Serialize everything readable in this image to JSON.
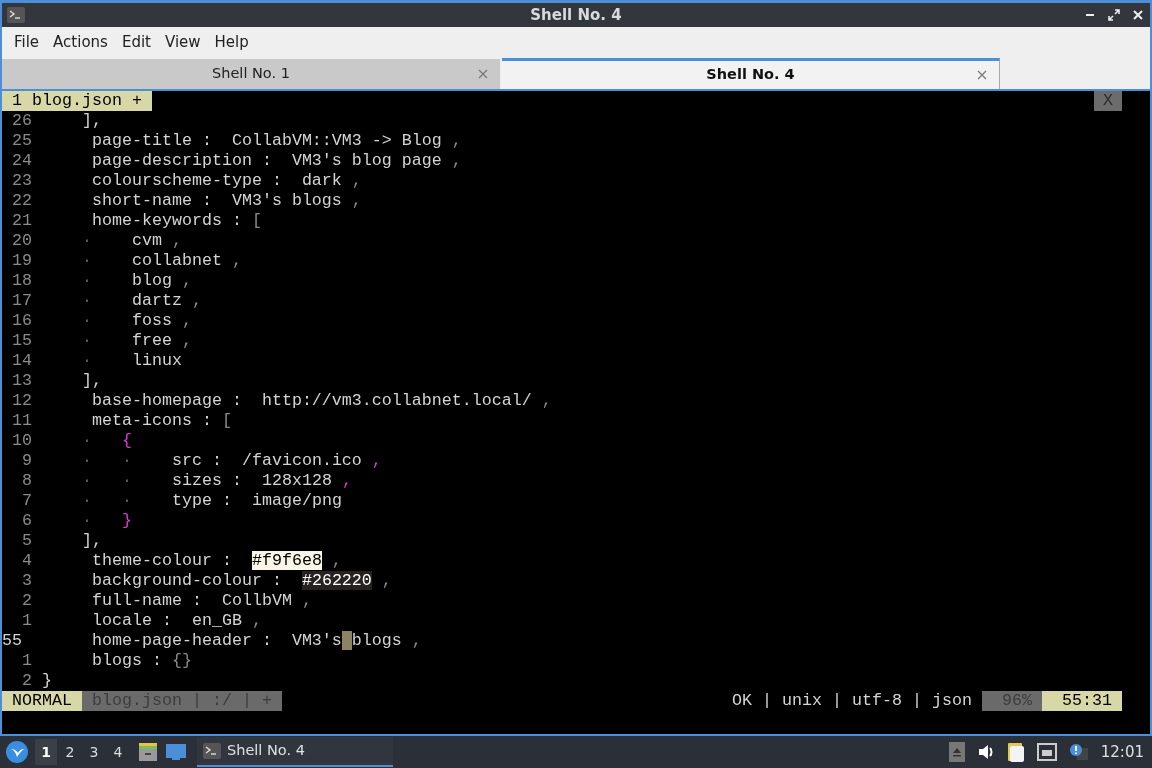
{
  "window": {
    "title": "Shell No. 4"
  },
  "menu": [
    "File",
    "Actions",
    "Edit",
    "View",
    "Help"
  ],
  "tabs": [
    {
      "label": "Shell No. 1",
      "selected": false
    },
    {
      "label": "Shell No. 4",
      "selected": true
    }
  ],
  "editor": {
    "buffers": [
      {
        "label": "1 blog.json +",
        "selected": true
      }
    ],
    "close_label": "X",
    "lines": [
      {
        "number": "26",
        "current": false,
        "segments": [
          {
            "kind": "text",
            "text": "     ],"
          }
        ]
      },
      {
        "number": "25",
        "current": false,
        "segments": [
          {
            "kind": "text",
            "text": "      page-title :  CollabVM::VM3 -> Blog "
          },
          {
            "kind": "punct",
            "text": ","
          }
        ]
      },
      {
        "number": "24",
        "current": false,
        "segments": [
          {
            "kind": "text",
            "text": "      page-description :  VM3's blog page "
          },
          {
            "kind": "punct",
            "text": ","
          }
        ]
      },
      {
        "number": "23",
        "current": false,
        "segments": [
          {
            "kind": "text",
            "text": "      colourscheme-type :  dark "
          },
          {
            "kind": "punct",
            "text": ","
          }
        ]
      },
      {
        "number": "22",
        "current": false,
        "segments": [
          {
            "kind": "text",
            "text": "      short-name :  VM3's blogs "
          },
          {
            "kind": "punct",
            "text": ","
          }
        ]
      },
      {
        "number": "21",
        "current": false,
        "segments": [
          {
            "kind": "text",
            "text": "      home-keywords : "
          },
          {
            "kind": "punct",
            "text": "["
          }
        ]
      },
      {
        "number": "20",
        "current": false,
        "segments": [
          {
            "kind": "guide",
            "text": "     ·"
          },
          {
            "kind": "text",
            "text": "    cvm"
          },
          {
            "kind": "punct",
            "text": " ,"
          }
        ]
      },
      {
        "number": "19",
        "current": false,
        "segments": [
          {
            "kind": "guide",
            "text": "     ·"
          },
          {
            "kind": "text",
            "text": "    collabnet"
          },
          {
            "kind": "punct",
            "text": " ,"
          }
        ]
      },
      {
        "number": "18",
        "current": false,
        "segments": [
          {
            "kind": "guide",
            "text": "     ·"
          },
          {
            "kind": "text",
            "text": "    blog"
          },
          {
            "kind": "punct",
            "text": " ,"
          }
        ]
      },
      {
        "number": "17",
        "current": false,
        "segments": [
          {
            "kind": "guide",
            "text": "     ·"
          },
          {
            "kind": "text",
            "text": "    dartz"
          },
          {
            "kind": "punct",
            "text": " ,"
          }
        ]
      },
      {
        "number": "16",
        "current": false,
        "segments": [
          {
            "kind": "guide",
            "text": "     ·"
          },
          {
            "kind": "text",
            "text": "    foss"
          },
          {
            "kind": "punct",
            "text": " ,"
          }
        ]
      },
      {
        "number": "15",
        "current": false,
        "segments": [
          {
            "kind": "guide",
            "text": "     ·"
          },
          {
            "kind": "text",
            "text": "    free"
          },
          {
            "kind": "punct",
            "text": " ,"
          }
        ]
      },
      {
        "number": "14",
        "current": false,
        "segments": [
          {
            "kind": "guide",
            "text": "     ·"
          },
          {
            "kind": "text",
            "text": "    linux"
          }
        ]
      },
      {
        "number": "13",
        "current": false,
        "segments": [
          {
            "kind": "text",
            "text": "     ],"
          }
        ]
      },
      {
        "number": "12",
        "current": false,
        "segments": [
          {
            "kind": "text",
            "text": "      base-homepage :  http://vm3.collabnet.local/ "
          },
          {
            "kind": "punct",
            "text": ","
          }
        ]
      },
      {
        "number": "11",
        "current": false,
        "segments": [
          {
            "kind": "text",
            "text": "      meta-icons : "
          },
          {
            "kind": "punct",
            "text": "["
          }
        ]
      },
      {
        "number": "10",
        "current": false,
        "segments": [
          {
            "kind": "guide",
            "text": "     ·"
          },
          {
            "kind": "brace",
            "text": "   {"
          }
        ]
      },
      {
        "number": "9",
        "current": false,
        "segments": [
          {
            "kind": "guide",
            "text": "     ·   ·"
          },
          {
            "kind": "text",
            "text": "    src :  /favicon.ico"
          },
          {
            "kind": "brace",
            "text": " ,"
          }
        ]
      },
      {
        "number": "8",
        "current": false,
        "segments": [
          {
            "kind": "guide",
            "text": "     ·   ·"
          },
          {
            "kind": "text",
            "text": "    sizes :  128x128"
          },
          {
            "kind": "brace",
            "text": " ,"
          }
        ]
      },
      {
        "number": "7",
        "current": false,
        "segments": [
          {
            "kind": "guide",
            "text": "     ·   ·"
          },
          {
            "kind": "text",
            "text": "    type :  image/png"
          }
        ]
      },
      {
        "number": "6",
        "current": false,
        "segments": [
          {
            "kind": "guide",
            "text": "     ·"
          },
          {
            "kind": "brace",
            "text": "   }"
          }
        ]
      },
      {
        "number": "5",
        "current": false,
        "segments": [
          {
            "kind": "text",
            "text": "     ],"
          }
        ]
      },
      {
        "number": "4",
        "current": false,
        "segments": [
          {
            "kind": "text",
            "text": "      theme-colour :  "
          },
          {
            "kind": "swatch",
            "text": "#f9f6e8",
            "color": "#f9f6e8"
          },
          {
            "kind": "punct",
            "text": " ,"
          }
        ]
      },
      {
        "number": "3",
        "current": false,
        "segments": [
          {
            "kind": "text",
            "text": "      background-colour :  "
          },
          {
            "kind": "swatch",
            "text": "#262220",
            "color": "#262220"
          },
          {
            "kind": "punct",
            "text": " ,"
          }
        ]
      },
      {
        "number": "2",
        "current": false,
        "segments": [
          {
            "kind": "text",
            "text": "      full-name :  CollbVM "
          },
          {
            "kind": "punct",
            "text": ","
          }
        ]
      },
      {
        "number": "1",
        "current": false,
        "segments": [
          {
            "kind": "text",
            "text": "      locale :  en_GB "
          },
          {
            "kind": "punct",
            "text": ","
          }
        ]
      },
      {
        "number": "55",
        "current": true,
        "segments": [
          {
            "kind": "text",
            "text": "      home-page-header :  VM3's"
          },
          {
            "kind": "cursor",
            "text": " blogs"
          },
          {
            "kind": "punct",
            "text": " ,"
          }
        ]
      },
      {
        "number": "1",
        "current": false,
        "segments": [
          {
            "kind": "text",
            "text": "      blogs : "
          },
          {
            "kind": "punct",
            "text": "{}"
          }
        ]
      },
      {
        "number": "2",
        "current": false,
        "segments": [
          {
            "kind": "text",
            "text": " }"
          }
        ]
      }
    ],
    "status": {
      "mode": "NORMAL",
      "file_info": "blog.json | :/ | +",
      "file_meta": "OK | unix | utf-8 | json",
      "percent": "96%",
      "position": "55:31"
    }
  },
  "taskbar": {
    "workspaces": [
      {
        "label": "1",
        "selected": true
      },
      {
        "label": "2",
        "selected": false
      },
      {
        "label": "3",
        "selected": false
      },
      {
        "label": "4",
        "selected": false
      }
    ],
    "tasks": [
      {
        "label": "Shell No. 4",
        "selected": true
      }
    ],
    "clock": "12:01"
  }
}
